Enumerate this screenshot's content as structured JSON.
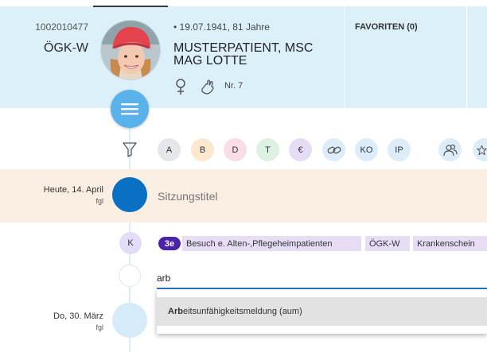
{
  "patient": {
    "id": "1002010477",
    "insurer": "ÖGK-W",
    "birth": "• 19.07.1941, 81 Jahre",
    "name_line1": "MUSTERPATIENT, MSC",
    "name_line2": "MAG LOTTE",
    "nr": "Nr. 7",
    "avatar_icon": "patient-photo"
  },
  "favorites": {
    "label": "FAVORITEN (0)"
  },
  "filters": {
    "chips": [
      {
        "label": "A",
        "color": "#e4e6ea"
      },
      {
        "label": "B",
        "color": "#fbe8cf"
      },
      {
        "label": "D",
        "color": "#f8dde6"
      },
      {
        "label": "T",
        "color": "#ddf1e2"
      },
      {
        "label": "€",
        "color": "#e6dcf6"
      },
      {
        "label": "",
        "icon": "link-icon",
        "color": "#dcedf9"
      },
      {
        "label": "KO",
        "color": "#dcedf9"
      },
      {
        "label": "IP",
        "color": "#dcedf9"
      },
      {
        "label": "",
        "icon": "people-icon",
        "color": "#dcedf9"
      },
      {
        "label": "",
        "icon": "star-icon",
        "color": "#dcedf9"
      }
    ]
  },
  "timeline": {
    "today": {
      "date": "Heute, 14. April",
      "user": "fgl",
      "session_placeholder": "Sitzungstitel"
    },
    "entry": {
      "type": "K",
      "code": "3e",
      "tags": [
        "Besuch e. Alten-,Pflegeheimpatienten",
        "ÖGK-W",
        "Krankenschein"
      ],
      "input_value": "arb",
      "suggestion_match": "Arb",
      "suggestion_rest": "eitsunfähigkeitsmeldung (aum)"
    },
    "previous": {
      "date": "Do, 30. März",
      "user": "fgl"
    }
  },
  "colors": {
    "header_bg": "#dcf0fa",
    "accent": "#5ab2ea",
    "today_dot": "#0a70c4",
    "code_badge": "#4b23a9",
    "today_band": "#fbeee2"
  }
}
